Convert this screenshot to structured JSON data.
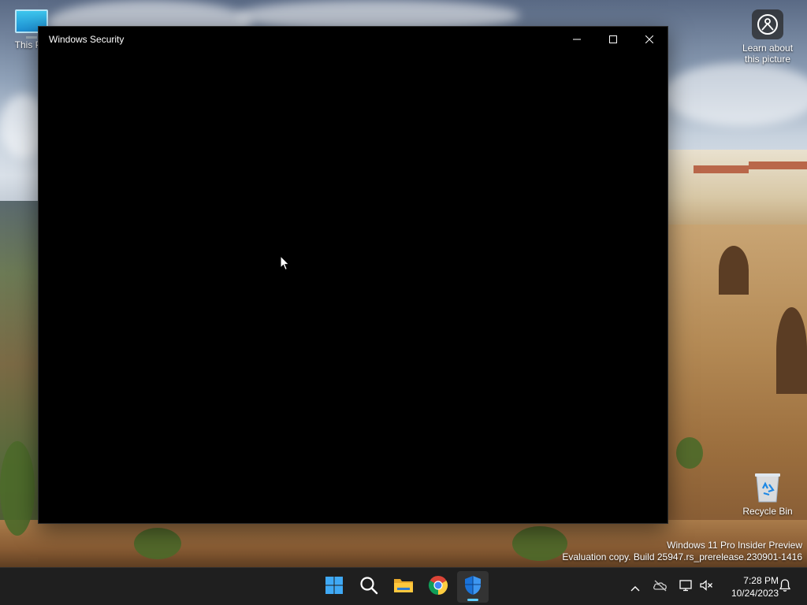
{
  "desktop": {
    "icons": [
      {
        "label": "This PC",
        "icon": "monitor-icon"
      },
      {
        "label": "Learn about this picture",
        "icon": "learn-about-picture-icon"
      },
      {
        "label": "Recycle Bin",
        "icon": "recycle-bin-icon"
      }
    ],
    "watermark": {
      "line1": "Windows 11 Pro Insider Preview",
      "line2": "Evaluation copy. Build 25947.rs_prerelease.230901-1416"
    }
  },
  "window": {
    "title": "Windows Security",
    "controls": [
      "minimize-icon",
      "maximize-icon",
      "close-icon"
    ],
    "content_background": "#000000"
  },
  "taskbar": {
    "apps": [
      {
        "name": "Start",
        "icon": "windows-start-icon",
        "active": false
      },
      {
        "name": "Search",
        "icon": "search-icon",
        "active": false
      },
      {
        "name": "File Explorer",
        "icon": "folder-icon",
        "active": false
      },
      {
        "name": "Google Chrome",
        "icon": "chrome-icon",
        "active": false
      },
      {
        "name": "Windows Security",
        "icon": "shield-icon",
        "active": true
      }
    ],
    "tray": {
      "icons": [
        "chevron-up-icon",
        "onedrive-offline-icon",
        "network-icon",
        "volume-muted-icon",
        "notification-bell-icon"
      ],
      "time": "7:28 PM",
      "date": "10/24/2023"
    }
  },
  "colors": {
    "accent": "#60cdff",
    "taskbar": "#1f1f1f",
    "window_bg": "#000000"
  }
}
